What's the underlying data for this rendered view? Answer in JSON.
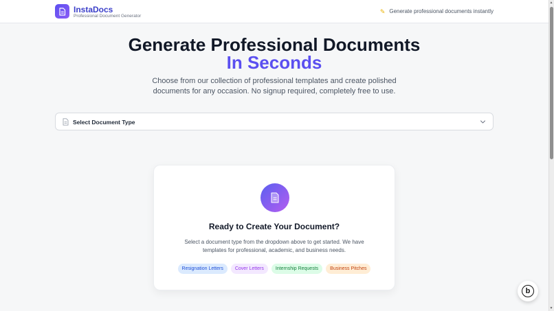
{
  "header": {
    "brand_name": "InstaDocs",
    "brand_sub": "Professional Document Generator",
    "tagline": "Generate professional documents instantly",
    "logo_icon": "document-icon",
    "tagline_icon": "sparkle-icon"
  },
  "hero": {
    "title_line1": "Generate Professional Documents",
    "title_line2": "In Seconds",
    "description": "Choose from our collection of professional templates and create polished documents for any occasion. No signup required, completely free to use."
  },
  "select": {
    "label": "Select Document Type",
    "icon": "document-icon",
    "chevron_icon": "chevron-down-icon"
  },
  "card": {
    "icon": "document-icon",
    "title": "Ready to Create Your Document?",
    "description": "Select a document type from the dropdown above to get started. We have templates for professional, academic, and business needs.",
    "chips": [
      {
        "label": "Resignation Letters"
      },
      {
        "label": "Cover Letters"
      },
      {
        "label": "Internship Requests"
      },
      {
        "label": "Business Pitches"
      }
    ]
  },
  "badge": {
    "letter": "b",
    "icon": "made-with-badge-icon"
  },
  "colors": {
    "accent": "#5b4ff0",
    "accent_gradient_end": "#b45ef0",
    "background": "#f6f7f8"
  }
}
